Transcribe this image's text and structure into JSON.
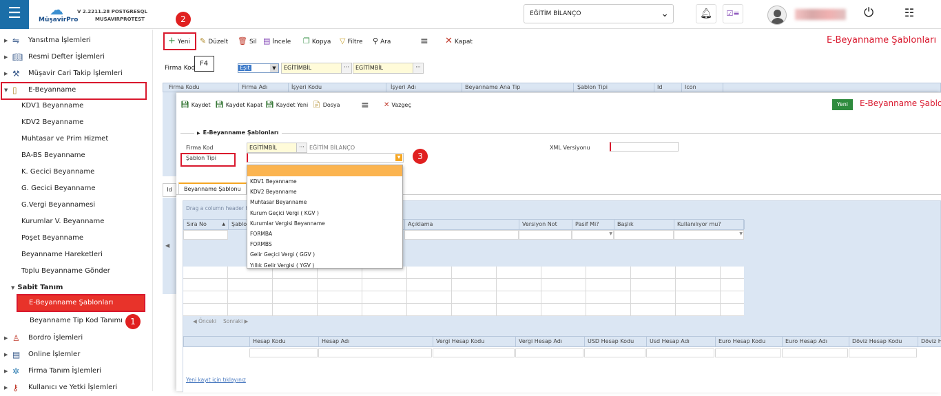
{
  "header": {
    "logo_text": "MüşavirPro",
    "version_line1": "V 2.2211.28 POSTGRESQL",
    "version_line2": "MUSAVIRPROTEST",
    "company": "EĞİTİM BİLANÇO"
  },
  "sidebar": {
    "items": [
      {
        "label": "Yansıtma İşlemleri",
        "icon": "mirror-icon"
      },
      {
        "label": "Resmi Defter İşlemleri",
        "icon": "book-icon"
      },
      {
        "label": "Müşavir Cari Takip İşlemleri",
        "icon": "tools-icon"
      },
      {
        "label": "E-Beyanname",
        "icon": "phone-doc-icon"
      }
    ],
    "sub_items": [
      "KDV1 Beyanname",
      "KDV2 Beyanname",
      "Muhtasar ve Prim Hizmet",
      "BA-BS Beyanname",
      "K. Gecici  Beyanname",
      "G. Gecici  Beyanname",
      "G.Vergi  Beyannamesi",
      "Kurumlar V.  Beyanname",
      "Poşet Beyanname",
      "Beyanname Hareketleri",
      "Toplu Beyanname Gönder"
    ],
    "group_label": "Sabit Tanım",
    "active_item": "E-Beyanname Şablonları",
    "next_item": "Beyanname Tip Kod Tanımı",
    "bottom_items": [
      {
        "label": "Bordro İşlemleri",
        "icon": "person-icon"
      },
      {
        "label": "Online İşlemler",
        "icon": "window-icon"
      },
      {
        "label": "Firma Tanım İşlemleri",
        "icon": "network-icon"
      },
      {
        "label": "Kullanıcı ve Yetki İşlemleri",
        "icon": "key-icon"
      }
    ]
  },
  "toolbar": {
    "yeni": "Yeni",
    "duzelt": "Düzelt",
    "sil": "Sil",
    "incele": "İncele",
    "kopya": "Kopya",
    "filtre": "Filtre",
    "ara": "Ara",
    "kapat": "Kapat",
    "tooltip": "F4"
  },
  "page_title": "E-Beyanname Şablonları",
  "filter": {
    "label": "Firma Kod",
    "select_value": "Eşit",
    "input1": "EGİTİMBİL",
    "input2": "EGİTİMBİL"
  },
  "bg_grid_headers": [
    "Firma Kodu",
    "Firma Adı",
    "İşyeri Kodu",
    "İşyeri Adı",
    "Beyanname Ana Tip",
    "Şablon Tipi",
    "Id",
    "Icon"
  ],
  "bg_tab_fragment": "Id",
  "modal": {
    "toolbar": {
      "kaydet": "Kaydet",
      "kaydet_kapat": "Kaydet Kapat",
      "kaydet_yeni": "Kaydet Yeni",
      "dosya": "Dosya",
      "vazgec": "Vazgeç"
    },
    "mode_tag": "Yeni",
    "title": "E-Beyanname Şablonları",
    "section_title": "E-Beyanname Şablonları",
    "firma_kod_label": "Firma Kod",
    "firma_kod_value": "EGİTİMBİL",
    "firma_name": "EĞİTİM BİLANÇO",
    "xml_label": "XML Versiyonu",
    "sablon_tipi_label": "Şablon Tipi",
    "dropdown_options": [
      "",
      "KDV1 Beyanname",
      "KDV2 Beyanname",
      "Muhtasar Beyanname",
      "Kurum Geçici Vergi ( KGV )",
      "Kurumlar Vergisi Beyanname",
      "FORMBA",
      "FORMBS",
      "Gelir Geçici Vergi ( GGV )",
      "Yıllık Gelir Vergisi ( YGV )"
    ],
    "tab_label": "Beyanname Şablonu",
    "group_hint": "Drag a column header he",
    "grid1_headers": [
      "Sıra No",
      "Şablon",
      "",
      "Açıklama",
      "Versiyon Not",
      "Pasif Mi?",
      "Başlık",
      "Kullanılıyor mu?"
    ],
    "pager_prev": "Önceki",
    "pager_next": "Sonraki",
    "grid2_headers": [
      "",
      "Hesap Kodu",
      "Hesap Adı",
      "Vergi Hesap Kodu",
      "Vergi Hesap Adı",
      "USD Hesap Kodu",
      "Usd Hesap Adı",
      "Euro Hesap Kodu",
      "Euro Hesap Adı",
      "Döviz Hesap Kodu",
      "Döviz H"
    ],
    "new_record_link": "Yeni kayıt için tıklayınız"
  },
  "badges": [
    "1",
    "2",
    "3"
  ],
  "colors": {
    "accent": "#1b6ea8",
    "highlight": "#d9182d",
    "option_hover": "#fbb450",
    "success": "#2e8b3e"
  }
}
